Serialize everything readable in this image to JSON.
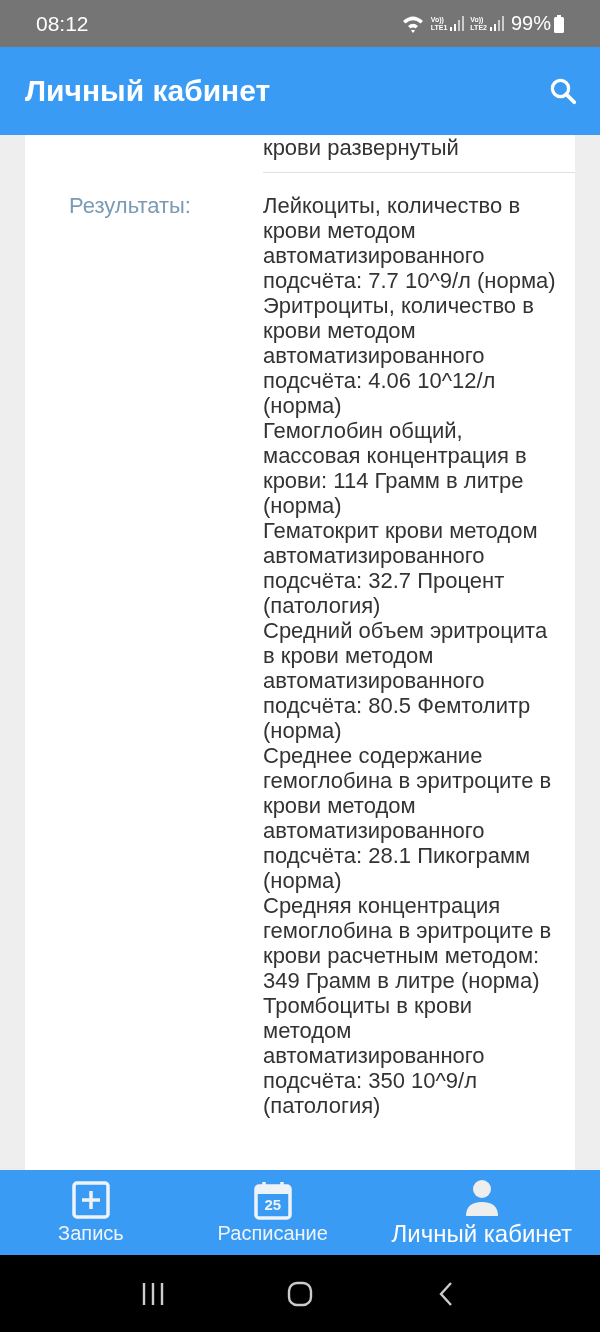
{
  "status_bar": {
    "time": "08:12",
    "sims": [
      {
        "top": "Vo))",
        "bottom": "LTE1"
      },
      {
        "top": "Vo))",
        "bottom": "LTE2"
      }
    ],
    "battery": "99%"
  },
  "app_bar": {
    "title": "Личный кабинет"
  },
  "details": {
    "prev_value_tail": "крови развернутый",
    "label": "Результаты:",
    "results": [
      "Лейкоциты, количество в крови методом автоматизированного подсчёта: 7.7 10^9/л (норма)",
      "Эритроциты, количество в крови методом автоматизированного подсчёта: 4.06 10^12/л (норма)",
      "Гемоглобин общий, массовая концентрация в крови: 114 Грамм в литре (норма)",
      "Гематокрит крови методом автоматизированного подсчёта: 32.7 Процент (патология)",
      "Средний объем эритроцита в крови методом автоматизированного подсчёта: 80.5 Фемтолитр (норма)",
      "Среднее содержание гемоглобина в эритроците в крови методом автоматизированного подсчёта: 28.1 Пикограмм (норма)",
      "Средняя концентрация гемоглобина в эритроците в крови расчетным методом: 349 Грамм в литре (норма)",
      "Тромбоциты в крови методом автоматизированного подсчёта: 350 10^9/л (патология)"
    ]
  },
  "tabs": [
    {
      "label": "Запись",
      "kind": "add",
      "selected": false
    },
    {
      "label": "Расписание",
      "kind": "calendar",
      "day": "25",
      "selected": false
    },
    {
      "label": "Личный кабинет",
      "kind": "person",
      "selected": true
    }
  ]
}
